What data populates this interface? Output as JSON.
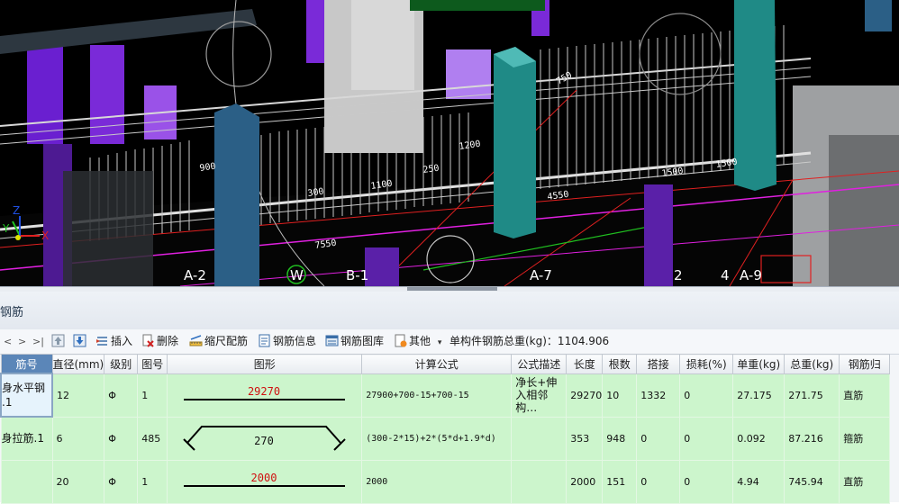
{
  "viewport": {
    "grid_labels": [
      "A-2",
      "W",
      "B-1",
      "A-7",
      "4",
      "A-9",
      "2"
    ],
    "dimension_labels": [
      "7550",
      "4550",
      "1500",
      "1200",
      "1500",
      "1100",
      "300",
      "750",
      "250",
      "900"
    ],
    "axis_labels": {
      "x": "X",
      "y": "Y",
      "z": "Z"
    },
    "colors": {
      "background": "#000000",
      "pink_line": "#e020e0",
      "red_line": "#e02020",
      "green_line": "#20c020",
      "column_teal": "#1f8a86",
      "column_blue": "#2b5f86",
      "purple": "#7a22c9"
    }
  },
  "panel": {
    "title": "钢筋"
  },
  "toolbar": {
    "nav": [
      "<",
      ">",
      ">|"
    ],
    "insert": "插入",
    "delete": "删除",
    "scale_bar": "缩尺配筋",
    "rebar_info": "钢筋信息",
    "rebar_library": "钢筋图库",
    "other": "其他",
    "dropdown_arrow": "▾",
    "total_weight_label": "单构件钢筋总重(kg)：1104.906"
  },
  "table": {
    "headers": [
      "筋号",
      "直径(mm)",
      "级别",
      "图号",
      "图形",
      "计算公式",
      "公式描述",
      "长度",
      "根数",
      "搭接",
      "损耗(%)",
      "单重(kg)",
      "总重(kg)",
      "钢筋归"
    ],
    "rows": [
      {
        "name": "身水平钢\n.1",
        "diameter": "12",
        "grade": "Φ",
        "fig_no": "1",
        "shape_value": "29270",
        "formula": "27900+700-15+700-15",
        "desc": "净长+伸入相邻构…",
        "length": "29270",
        "count": "10",
        "lap": "1332",
        "loss": "0",
        "unit_weight": "27.175",
        "total_weight": "271.75",
        "category": "直筋"
      },
      {
        "name": "身拉筋.1",
        "diameter": "6",
        "grade": "Φ",
        "fig_no": "485",
        "shape_value": "270",
        "formula": "(300-2*15)+2*(5*d+1.9*d)",
        "desc": "",
        "length": "353",
        "count": "948",
        "lap": "0",
        "loss": "0",
        "unit_weight": "0.092",
        "total_weight": "87.216",
        "category": "箍筋"
      },
      {
        "name": "",
        "diameter": "20",
        "grade": "Φ",
        "fig_no": "1",
        "shape_value": "2000",
        "formula": "2000",
        "desc": "",
        "length": "2000",
        "count": "151",
        "lap": "0",
        "loss": "0",
        "unit_weight": "4.94",
        "total_weight": "745.94",
        "category": "直筋"
      }
    ]
  },
  "colors": {
    "row_bg": "#ccf5cc",
    "shape_value_red": "#d01010",
    "header_first": "#5b86b8"
  }
}
